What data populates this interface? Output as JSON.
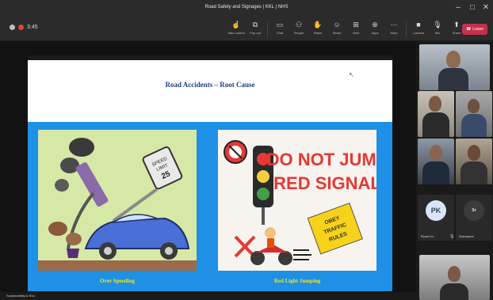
{
  "window": {
    "title": "Road Safety and Signages | KKL | NHS"
  },
  "toolbar": {
    "timer": "3:45",
    "items": [
      {
        "label": "Take control",
        "icon": "hand-icon"
      },
      {
        "label": "Pop out",
        "icon": "popout-icon"
      },
      {
        "label": "Chat",
        "icon": "chat-icon"
      },
      {
        "label": "People",
        "icon": "people-icon"
      },
      {
        "label": "Raise",
        "icon": "raise-hand-icon"
      },
      {
        "label": "React",
        "icon": "react-icon"
      },
      {
        "label": "View",
        "icon": "view-icon"
      },
      {
        "label": "Apps",
        "icon": "apps-icon"
      },
      {
        "label": "More",
        "icon": "more-icon"
      },
      {
        "label": "Camera",
        "icon": "camera-icon"
      },
      {
        "label": "Mic",
        "icon": "mic-icon"
      },
      {
        "label": "Share",
        "icon": "share-icon"
      }
    ],
    "leave_label": "Leave"
  },
  "slide": {
    "title": "Road Accidents – Root Cause",
    "left_caption": "Over Speeding",
    "right_caption": "Red Light Jumping",
    "sign_top": "SPEED LIMIT 25",
    "do_not_line1": "DO NOT JUMP",
    "do_not_line2": "RED SIGNAL",
    "obey_line1": "OBEY",
    "obey_line2": "TRAFFIC",
    "obey_line3": "RULES"
  },
  "status_strip": {
    "presenter": "Sustainability & Ros"
  },
  "participants": {
    "pk_initials": "PK",
    "pk_name": "Piyush Ko...",
    "sr_initials": "Sr",
    "sr_name": "Sshkuppera"
  },
  "colors": {
    "leave": "#c4314b",
    "slide_blue": "#1e90e6",
    "caption_yellow": "#f7e11a",
    "title_navy": "#1f3f8a"
  }
}
